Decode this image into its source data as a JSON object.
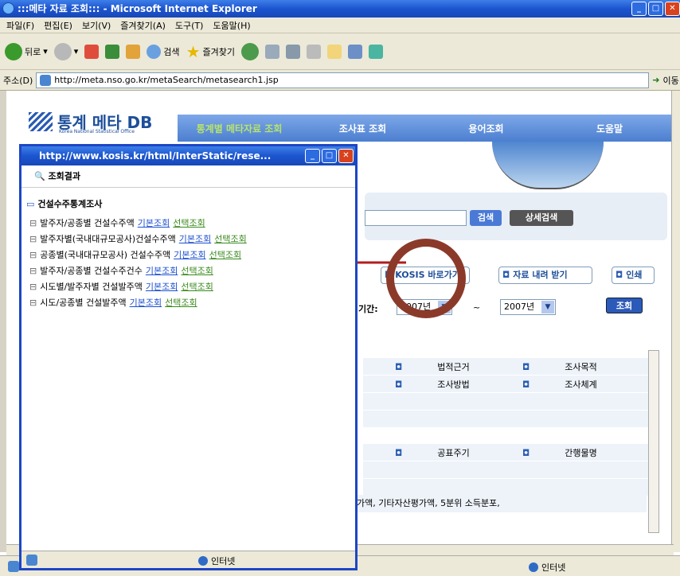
{
  "window": {
    "title": ":::메타 자료 조회::: - Microsoft Internet Explorer"
  },
  "menu": [
    "파일(F)",
    "편집(E)",
    "보기(V)",
    "즐겨찾기(A)",
    "도구(T)",
    "도움말(H)"
  ],
  "toolbar": {
    "back": "뒤로",
    "search": "검색",
    "favorites": "즐겨찾기"
  },
  "address": {
    "label": "주소(D)",
    "url": "http://meta.nso.go.kr/metaSearch/metasearch1.jsp",
    "go": "이동"
  },
  "site": {
    "logo_title": "통계 메타 DB",
    "logo_sub": "Korea National Statistical Office",
    "nav": [
      "통계별 메타자료 조회",
      "조사표 조회",
      "용어조회",
      "도움말"
    ],
    "search_btn": "검색",
    "detail_search_btn": "상세검색",
    "kosis_btn": "KOSIS 바로가기",
    "download_btn": "자료 내려 받기",
    "print_btn": "인쇄",
    "period_label": "기간:",
    "period_from": "2007년",
    "period_sep": "~",
    "period_to": "2007년",
    "query_btn": "조회",
    "info": [
      [
        "법적근거",
        "조사목적"
      ],
      [
        "조사방법",
        "조사체계"
      ],
      [
        "",
        ""
      ],
      [
        "",
        ""
      ],
      [
        "공표주기",
        "간행물명"
      ]
    ],
    "footer_text": "가액, 기타자산평가액, 5분위 소득분포,"
  },
  "popup": {
    "title": "http://www.kosis.kr/html/InterStatic/rese...",
    "header": "조회결과",
    "root": "건설수주통계조사",
    "items": [
      {
        "label": "발주자/공종별 건설수주액",
        "basic": "기본조회",
        "select": "선택조회"
      },
      {
        "label": "발주자별(국내대규모공사)건설수주액",
        "basic": "기본조회",
        "select": "선택조회"
      },
      {
        "label": "공종별(국내대규모공사) 건설수주액",
        "basic": "기본조회",
        "select": "선택조회"
      },
      {
        "label": "발주자/공종별 건설수주건수",
        "basic": "기본조회",
        "select": "선택조회"
      },
      {
        "label": "시도별/발주자별 건설발주액",
        "basic": "기본조회",
        "select": "선택조회"
      },
      {
        "label": "시도/공종별 건설발주액",
        "basic": "기본조회",
        "select": "선택조회"
      }
    ],
    "status": "인터넷"
  },
  "status": {
    "zone": "인터넷"
  }
}
